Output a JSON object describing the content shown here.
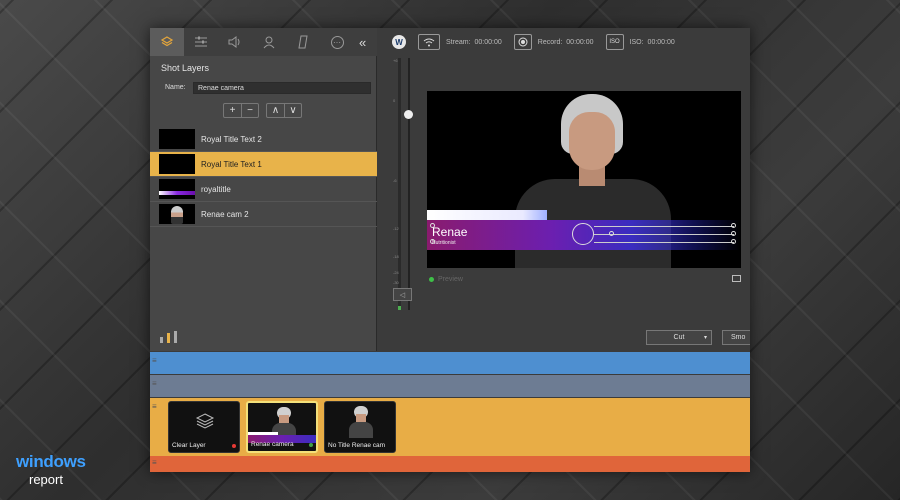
{
  "left_panel": {
    "tabs": [
      {
        "icon": "layers-icon"
      },
      {
        "icon": "sliders-icon"
      },
      {
        "icon": "speaker-icon"
      },
      {
        "icon": "person-icon"
      },
      {
        "icon": "card-icon"
      },
      {
        "icon": "more-icon",
        "glyph": "⋯"
      }
    ],
    "collapse_glyph": "«",
    "title": "Shot Layers",
    "name_label": "Name:",
    "name_value": "Renae camera",
    "add_glyph": "+",
    "remove_glyph": "−",
    "up_glyph": "∧",
    "down_glyph": "∨",
    "layers": [
      {
        "name": "Royal Title Text 2",
        "selected": false,
        "thumb": "black"
      },
      {
        "name": "Royal Title Text 1",
        "selected": true,
        "thumb": "black"
      },
      {
        "name": "royaltitle",
        "selected": false,
        "thumb": "title"
      },
      {
        "name": "Renae cam 2",
        "selected": false,
        "thumb": "person"
      }
    ]
  },
  "topbar": {
    "logo": "W",
    "stream_label": "Stream:",
    "stream_time": "00:00:00",
    "record_label": "Record:",
    "record_time": "00:00:00",
    "iso_badge": "ISO",
    "iso_label": "ISO:",
    "iso_time": "00:00:00"
  },
  "vu_scale": [
    "+6",
    "0",
    "-6",
    "-12",
    "-18",
    "-24",
    "-30"
  ],
  "preview": {
    "lower_third_name": "Renae",
    "lower_third_subtitle": "Nutritionist",
    "label": "Preview"
  },
  "transition": {
    "type": "Cut",
    "smooth_label": "Smo"
  },
  "shots": [
    {
      "label": "Clear Layer",
      "status_color": "#e53935",
      "active": false,
      "kind": "clear"
    },
    {
      "label": "Renae camera",
      "status_color": "#43a047",
      "active": true,
      "kind": "title"
    },
    {
      "label": "No Title Renae cam",
      "status_color": "",
      "active": false,
      "kind": "person"
    }
  ],
  "colors": {
    "selected_layer": "#e8b34a",
    "band_blue": "#4e8fd0",
    "band_gray": "#6d7c93",
    "band_orange": "#e8ad46",
    "band_red": "#e0653a"
  },
  "watermark": {
    "line1": "windows",
    "line2": "report"
  }
}
